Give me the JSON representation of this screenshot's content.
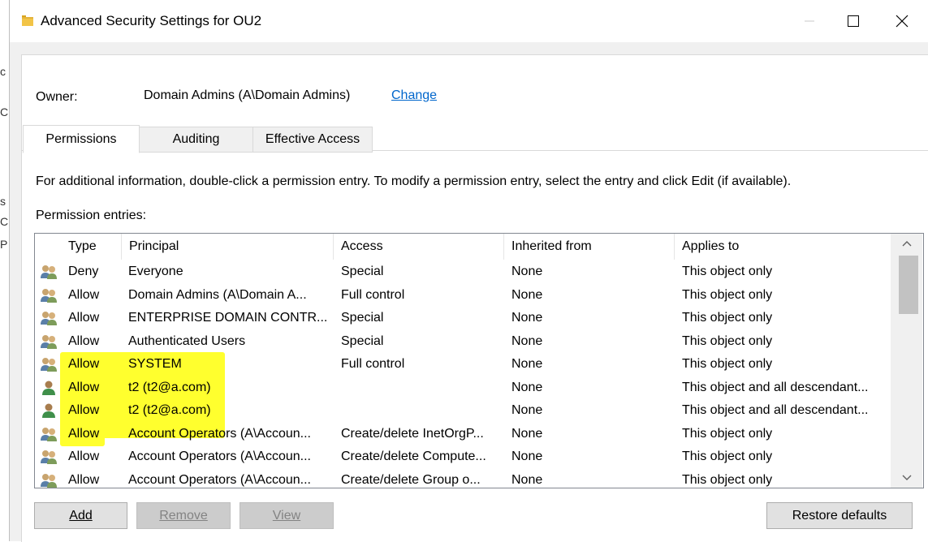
{
  "window": {
    "title": "Advanced Security Settings for OU2",
    "icons": [
      "folder-icon",
      "minimize-icon",
      "maximize-icon",
      "close-icon"
    ]
  },
  "owner": {
    "label": "Owner:",
    "value": "Domain Admins (A\\Domain Admins)",
    "change": "Change"
  },
  "tabs": [
    "Permissions",
    "Auditing",
    "Effective Access"
  ],
  "active_tab": "Permissions",
  "info_text": "For additional information, double-click a permission entry. To modify a permission entry, select the entry and click Edit (if available).",
  "entries_label": "Permission entries:",
  "columns": [
    "Type",
    "Principal",
    "Access",
    "Inherited from",
    "Applies to"
  ],
  "rows": [
    {
      "icon": "group-icon",
      "type": "Deny",
      "principal": "Everyone",
      "access": "Special",
      "inherited": "None",
      "applies": "This object only"
    },
    {
      "icon": "group-icon",
      "type": "Allow",
      "principal": "Domain Admins (A\\Domain A...",
      "access": "Full control",
      "inherited": "None",
      "applies": "This object only"
    },
    {
      "icon": "group-icon",
      "type": "Allow",
      "principal": "ENTERPRISE DOMAIN CONTR...",
      "access": "Special",
      "inherited": "None",
      "applies": "This object only"
    },
    {
      "icon": "group-icon",
      "type": "Allow",
      "principal": "Authenticated Users",
      "access": "Special",
      "inherited": "None",
      "applies": "This object only"
    },
    {
      "icon": "group-icon",
      "type": "Allow",
      "principal": "SYSTEM",
      "access": "Full control",
      "inherited": "None",
      "applies": "This object only"
    },
    {
      "icon": "user-icon",
      "type": "Allow",
      "principal": "t2 (t2@a.com)",
      "access": "",
      "inherited": "None",
      "applies": "This object and all descendant..."
    },
    {
      "icon": "user-icon",
      "type": "Allow",
      "principal": "t2 (t2@a.com)",
      "access": "",
      "inherited": "None",
      "applies": "This object and all descendant..."
    },
    {
      "icon": "group-icon",
      "type": "Allow",
      "principal": "Account Operators (A\\Accoun...",
      "access": "Create/delete InetOrgP...",
      "inherited": "None",
      "applies": "This object only"
    },
    {
      "icon": "group-icon",
      "type": "Allow",
      "principal": "Account Operators (A\\Accoun...",
      "access": "Create/delete Compute...",
      "inherited": "None",
      "applies": "This object only"
    },
    {
      "icon": "group-icon",
      "type": "Allow",
      "principal": "Account Operators (A\\Accoun...",
      "access": "Create/delete Group o...",
      "inherited": "None",
      "applies": "This object only"
    }
  ],
  "buttons": {
    "add": {
      "label": "Add",
      "enabled": true
    },
    "remove": {
      "label": "Remove",
      "enabled": false
    },
    "view": {
      "label": "View",
      "enabled": false
    },
    "restore": {
      "label": "Restore defaults",
      "enabled": true
    }
  },
  "colors": {
    "highlight": "#ffff2e",
    "link": "#0066cc"
  },
  "background_fragments": [
    "c",
    "C",
    "s",
    "C",
    "P"
  ]
}
